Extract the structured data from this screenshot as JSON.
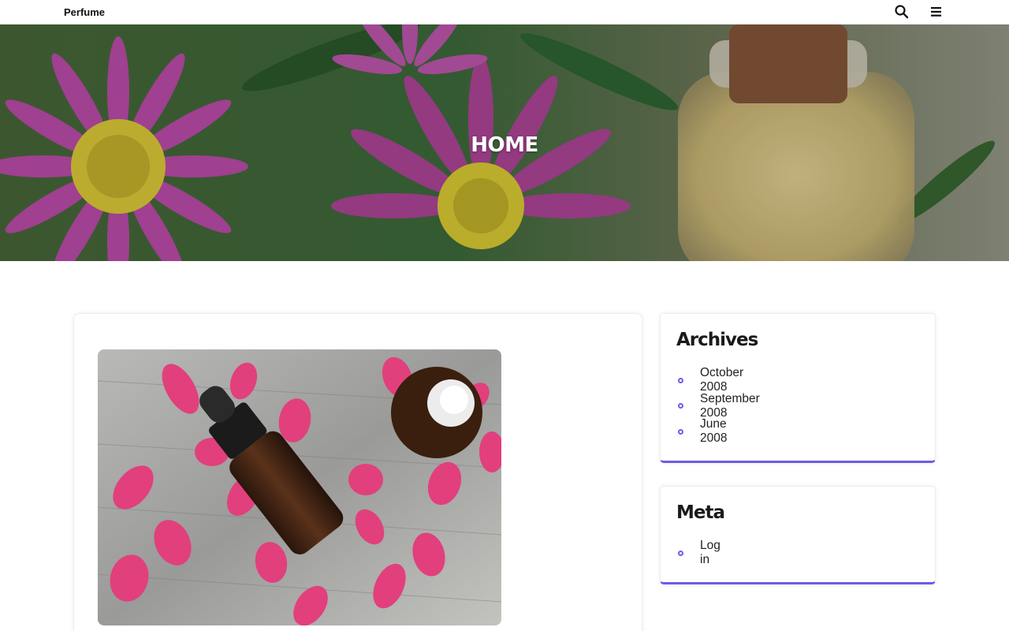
{
  "header": {
    "brand": "Perfume"
  },
  "hero": {
    "title": "HOME"
  },
  "sidebar": {
    "archives": {
      "title": "Archives",
      "items": [
        {
          "label": "October 2008"
        },
        {
          "label": "September 2008"
        },
        {
          "label": "June 2008"
        }
      ]
    },
    "meta": {
      "title": "Meta",
      "items": [
        {
          "label": "Log in"
        }
      ]
    }
  },
  "icons": {
    "search": "search-icon",
    "menu": "hamburger-menu-icon"
  },
  "colors": {
    "accent": "#6c5ce7"
  }
}
